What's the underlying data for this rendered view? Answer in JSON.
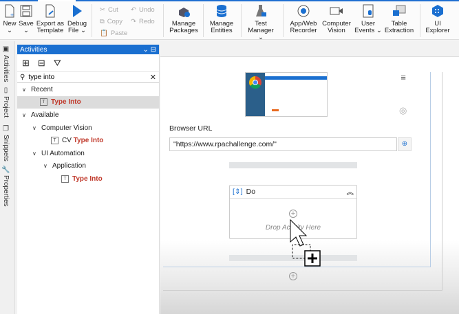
{
  "ribbon": {
    "new": "New",
    "save": "Save",
    "export": "Export as Template",
    "debug": "Debug File",
    "cut": "Cut",
    "copy": "Copy",
    "paste": "Paste",
    "undo": "Undo",
    "redo": "Redo",
    "manage_packages": "Manage Packages",
    "manage_entities": "Manage Entities",
    "test_manager": "Test Manager",
    "recorder": "App/Web Recorder",
    "computer_vision": "Computer Vision",
    "user_events": "User Events",
    "table_extraction": "Table Extraction",
    "ui_explorer": "UI Explorer"
  },
  "side_tabs": [
    "Activities",
    "Project",
    "Snippets",
    "Properties"
  ],
  "activities": {
    "title": "Activities",
    "search_value": "type into",
    "tree": {
      "recent": "Recent",
      "recent_item": "Type Into",
      "available": "Available",
      "cv": "Computer Vision",
      "cv_prefix": "CV",
      "cv_item": "Type Into",
      "uia": "UI Automation",
      "app": "Application",
      "app_item": "Type Into"
    }
  },
  "canvas": {
    "url_label": "Browser URL",
    "url_value": "\"https://www.rpachallenge.com/\"",
    "do_title": "Do",
    "drop_hint": "Drop Activity Here"
  },
  "colors": {
    "accent": "#1a6fd0",
    "match": "#c0392b"
  }
}
